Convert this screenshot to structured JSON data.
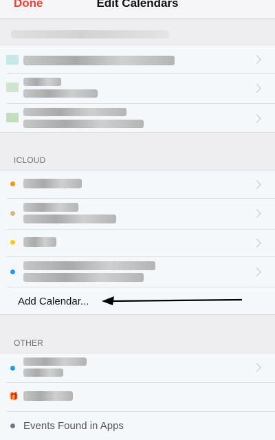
{
  "navbar": {
    "done_label": "Done",
    "title": "Edit Calendars"
  },
  "sections": {
    "icloud_header": "ICLOUD",
    "other_header": "OTHER"
  },
  "icloud": {
    "dot_colors": [
      "#ff9500",
      "#d4b87a",
      "#ffcc00",
      "#1a9bf0"
    ],
    "add_calendar_label": "Add Calendar..."
  },
  "other": {
    "dot_color": "#1a9bf0",
    "gift_icon_color": "#e04030",
    "events_found_label": "Events Found in Apps",
    "events_dot_color": "#6d7a8a"
  },
  "top_group": {
    "swatch_colors": [
      "#c6e8e8",
      "#cfe3d0",
      "#c4ddbf"
    ]
  }
}
